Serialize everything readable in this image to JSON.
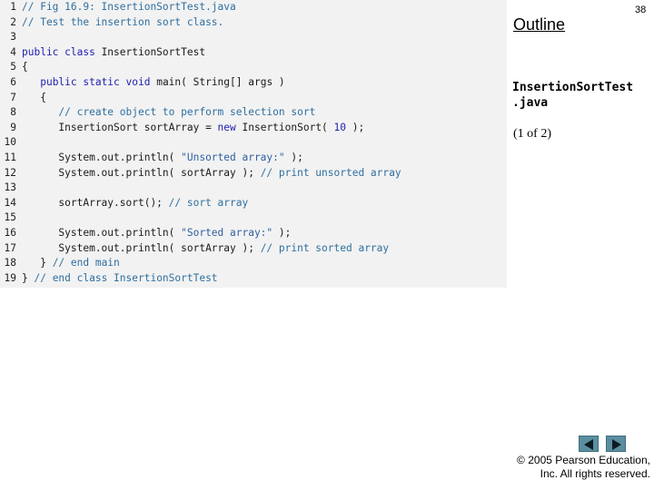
{
  "code": {
    "lines": [
      {
        "n": "1",
        "segs": [
          {
            "t": "// Fig 16.9: InsertionSortTest.java",
            "c": "cm"
          }
        ]
      },
      {
        "n": "2",
        "segs": [
          {
            "t": "// Test the insertion sort class.",
            "c": "cm"
          }
        ]
      },
      {
        "n": "3",
        "segs": []
      },
      {
        "n": "4",
        "segs": [
          {
            "t": "public class",
            "c": "kw"
          },
          {
            "t": " InsertionSortTest",
            "c": ""
          }
        ]
      },
      {
        "n": "5",
        "segs": [
          {
            "t": "{",
            "c": ""
          }
        ]
      },
      {
        "n": "6",
        "segs": [
          {
            "t": "   ",
            "c": ""
          },
          {
            "t": "public static void",
            "c": "kw"
          },
          {
            "t": " main( String[] args )",
            "c": ""
          }
        ]
      },
      {
        "n": "7",
        "segs": [
          {
            "t": "   {",
            "c": ""
          }
        ]
      },
      {
        "n": "8",
        "segs": [
          {
            "t": "      ",
            "c": ""
          },
          {
            "t": "// create object to perform selection sort",
            "c": "cm"
          }
        ]
      },
      {
        "n": "9",
        "segs": [
          {
            "t": "      InsertionSort sortArray = ",
            "c": ""
          },
          {
            "t": "new",
            "c": "kw"
          },
          {
            "t": " InsertionSort( ",
            "c": ""
          },
          {
            "t": "10",
            "c": "nm"
          },
          {
            "t": " );",
            "c": ""
          }
        ]
      },
      {
        "n": "10",
        "segs": []
      },
      {
        "n": "11",
        "segs": [
          {
            "t": "      System.out.println( ",
            "c": ""
          },
          {
            "t": "\"Unsorted array:\"",
            "c": "st"
          },
          {
            "t": " );",
            "c": ""
          }
        ]
      },
      {
        "n": "12",
        "segs": [
          {
            "t": "      System.out.println( sortArray ); ",
            "c": ""
          },
          {
            "t": "// print unsorted array",
            "c": "cm"
          }
        ]
      },
      {
        "n": "13",
        "segs": []
      },
      {
        "n": "14",
        "segs": [
          {
            "t": "      sortArray.sort(); ",
            "c": ""
          },
          {
            "t": "// sort array",
            "c": "cm"
          }
        ]
      },
      {
        "n": "15",
        "segs": []
      },
      {
        "n": "16",
        "segs": [
          {
            "t": "      System.out.println( ",
            "c": ""
          },
          {
            "t": "\"Sorted array:\"",
            "c": "st"
          },
          {
            "t": " );",
            "c": ""
          }
        ]
      },
      {
        "n": "17",
        "segs": [
          {
            "t": "      System.out.println( sortArray ); ",
            "c": ""
          },
          {
            "t": "// print sorted array",
            "c": "cm"
          }
        ]
      },
      {
        "n": "18",
        "segs": [
          {
            "t": "   } ",
            "c": ""
          },
          {
            "t": "// end main",
            "c": "cm"
          }
        ]
      },
      {
        "n": "19",
        "segs": [
          {
            "t": "} ",
            "c": ""
          },
          {
            "t": "// end class InsertionSortTest",
            "c": "cm"
          }
        ]
      }
    ]
  },
  "sidebar": {
    "outline_label": "Outline",
    "page_number": "38",
    "filename_line1": "InsertionSortTest",
    "filename_line2": ".java",
    "part_label": "(1 of 2)"
  },
  "nav": {
    "prev_icon": "triangle-left-icon",
    "next_icon": "triangle-right-icon",
    "button_color": "#5b8fa0"
  },
  "footer": {
    "copyright_line1": "© 2005 Pearson Education,",
    "copyright_line2": "Inc.  All rights reserved."
  }
}
